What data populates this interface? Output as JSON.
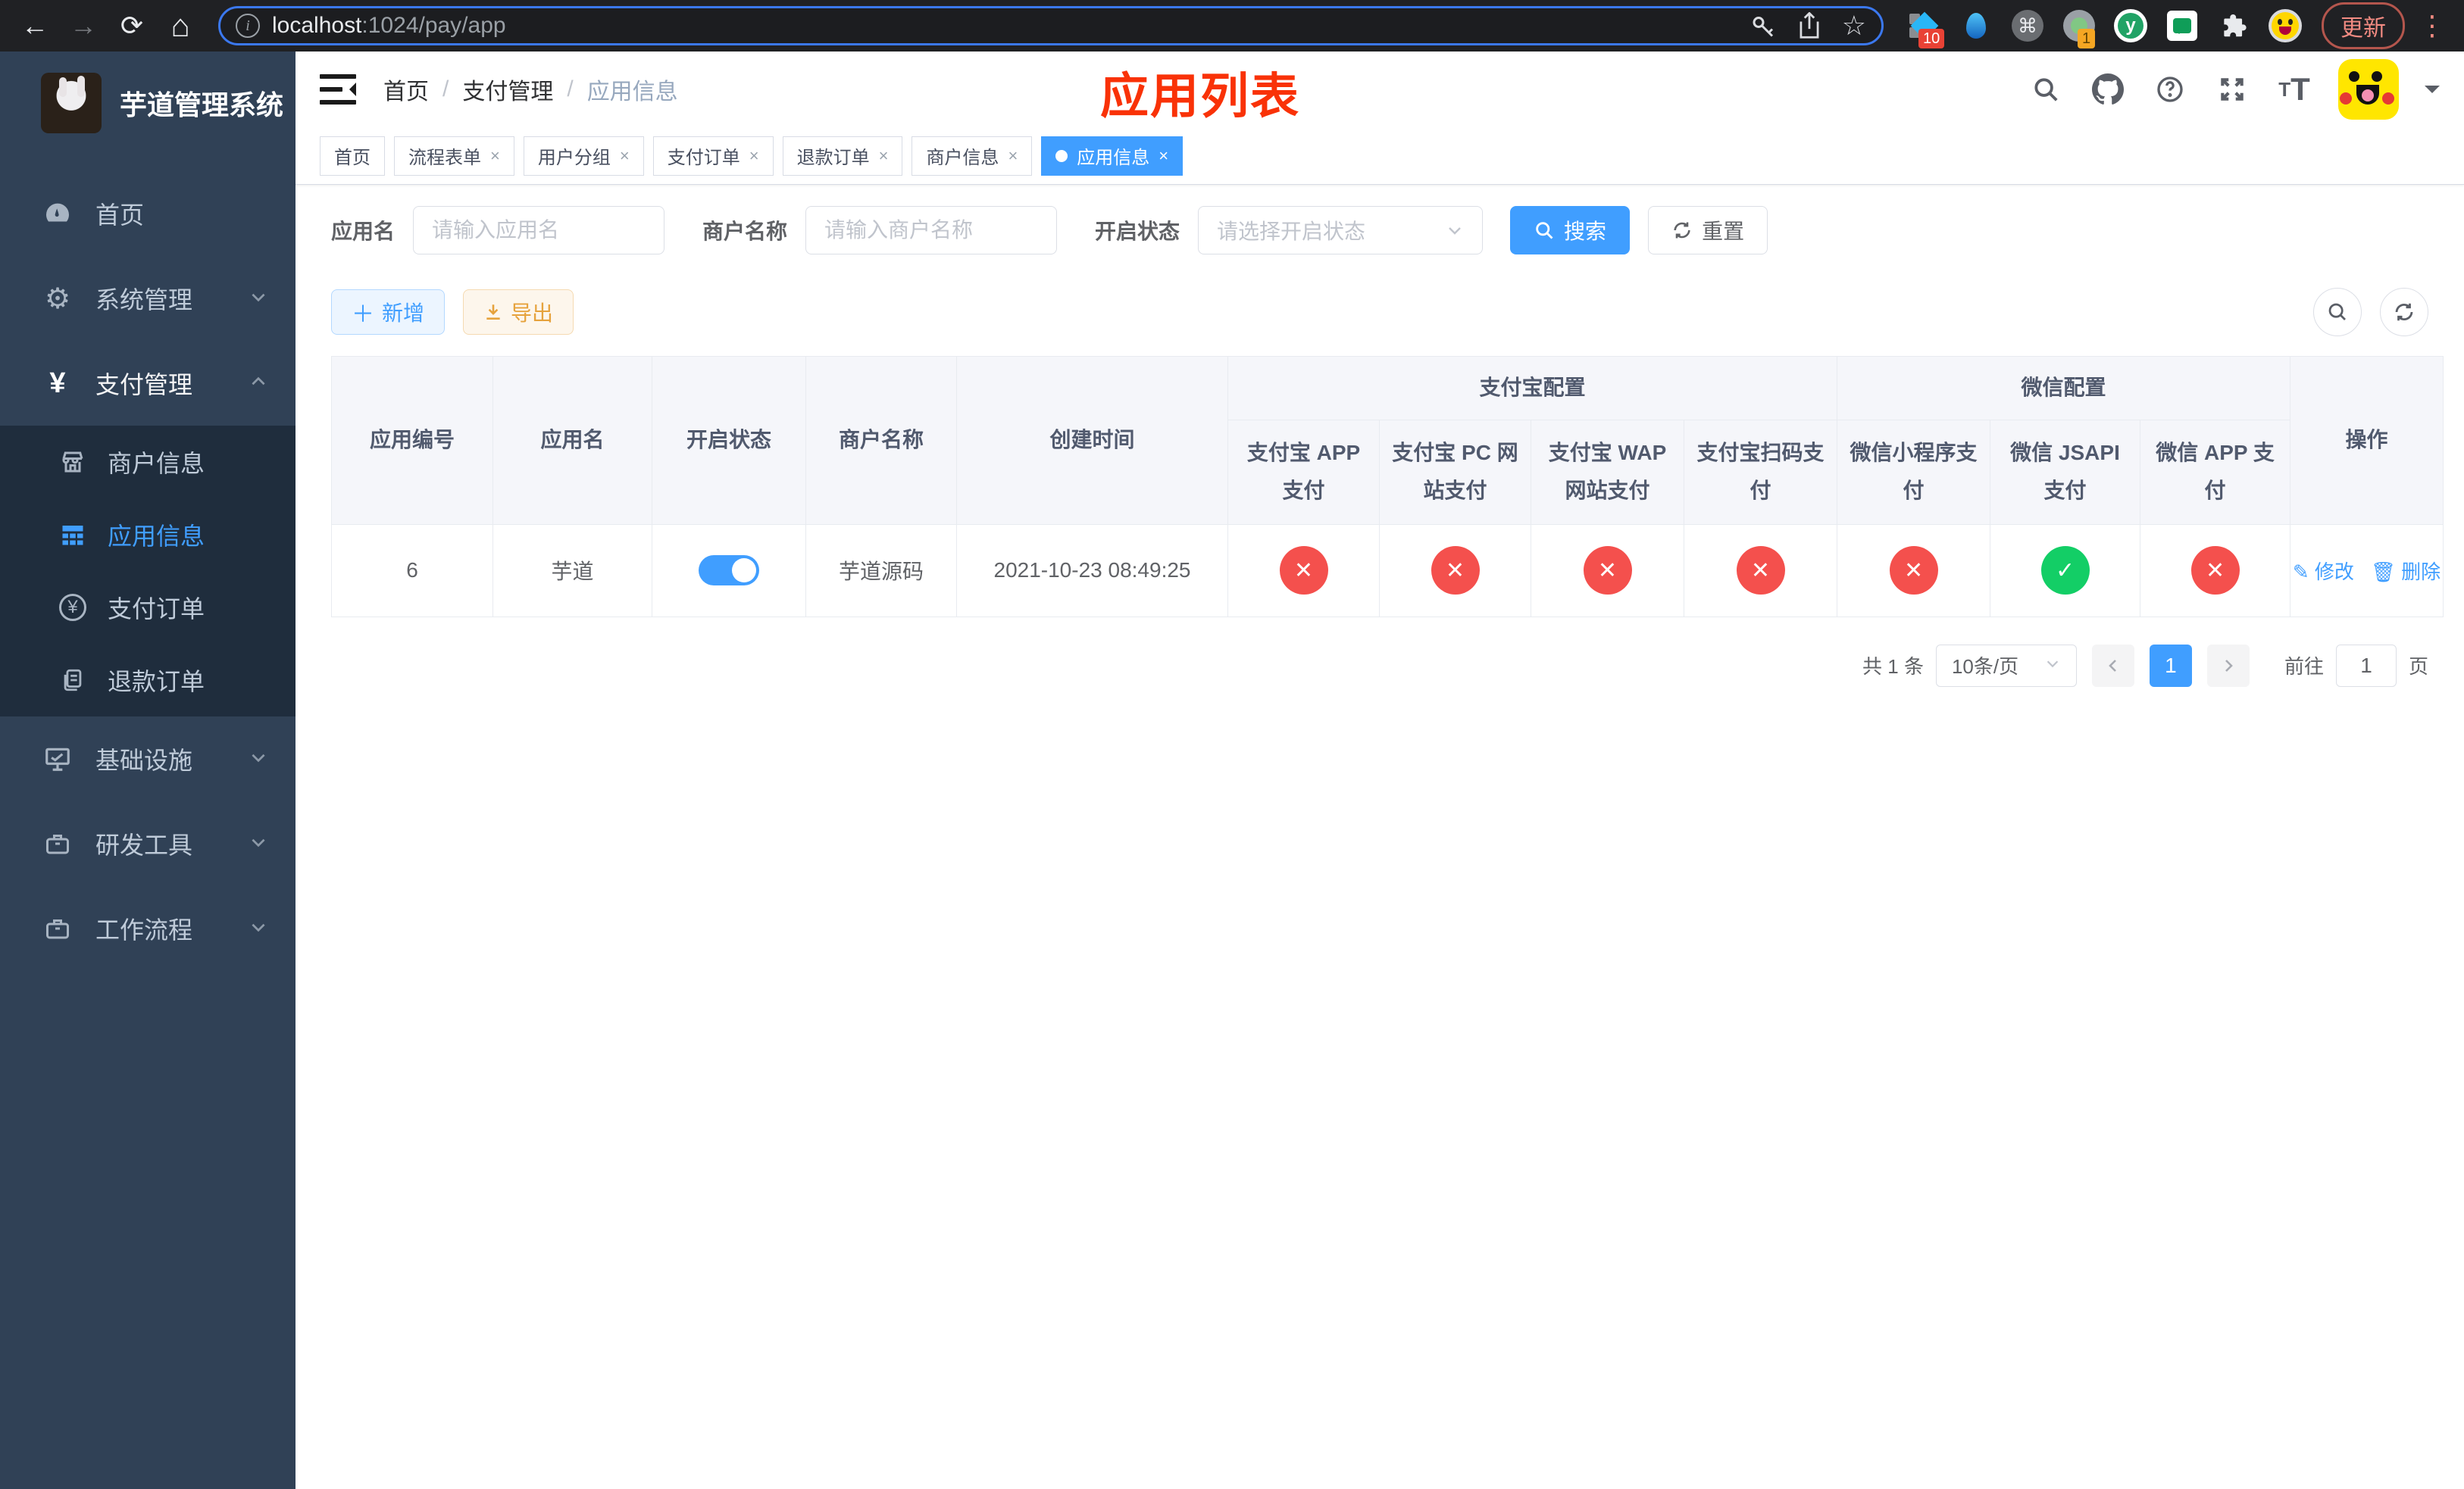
{
  "browser": {
    "url_host": "localhost",
    "url_rest": ":1024/pay/app",
    "update_label": "更新",
    "ext_badge_pin": "10",
    "ext_badge_rec": "1"
  },
  "sidebar": {
    "title": "芋道管理系统",
    "items": [
      {
        "label": "首页"
      },
      {
        "label": "系统管理"
      },
      {
        "label": "支付管理"
      },
      {
        "label": "基础设施"
      },
      {
        "label": "研发工具"
      },
      {
        "label": "工作流程"
      }
    ],
    "subitems": [
      {
        "label": "商户信息"
      },
      {
        "label": "应用信息"
      },
      {
        "label": "支付订单"
      },
      {
        "label": "退款订单"
      }
    ]
  },
  "navbar": {
    "breadcrumb": [
      "首页",
      "支付管理",
      "应用信息"
    ],
    "annotation": "应用列表"
  },
  "tags": [
    {
      "label": "首页"
    },
    {
      "label": "流程表单"
    },
    {
      "label": "用户分组"
    },
    {
      "label": "支付订单"
    },
    {
      "label": "退款订单"
    },
    {
      "label": "商户信息"
    },
    {
      "label": "应用信息"
    }
  ],
  "search": {
    "app_label": "应用名",
    "app_placeholder": "请输入应用名",
    "merchant_label": "商户名称",
    "merchant_placeholder": "请输入商户名称",
    "status_label": "开启状态",
    "status_placeholder": "请选择开启状态",
    "search_label": "搜索",
    "reset_label": "重置"
  },
  "toolbar": {
    "add_label": "新增",
    "export_label": "导出"
  },
  "table": {
    "groups": [
      "支付宝配置",
      "微信配置"
    ],
    "columns": [
      "应用编号",
      "应用名",
      "开启状态",
      "商户名称",
      "创建时间",
      "支付宝 APP 支付",
      "支付宝 PC 网站支付",
      "支付宝 WAP 网站支付",
      "支付宝扫码支付",
      "微信小程序支付",
      "微信 JSAPI 支付",
      "微信 APP 支付",
      "操作"
    ],
    "rows": [
      {
        "id": "6",
        "name": "芋道",
        "enabled": true,
        "merchant": "芋道源码",
        "created": "2021-10-23 08:49:25",
        "statuses": [
          false,
          false,
          false,
          false,
          false,
          true,
          false
        ]
      }
    ],
    "edit_label": "修改",
    "delete_label": "删除"
  },
  "pagination": {
    "total": "共 1 条",
    "page_size": "10条/页",
    "current_page": "1",
    "goto_label": "前往",
    "goto_value": "1",
    "page_unit": "页"
  },
  "colors": {
    "primary": "#409eff",
    "danger_circle": "#f4504d",
    "success_circle": "#13ce66",
    "sidebar_bg": "#304156",
    "submenu_bg": "#1f2d3d",
    "annotation_red": "#f93207"
  }
}
